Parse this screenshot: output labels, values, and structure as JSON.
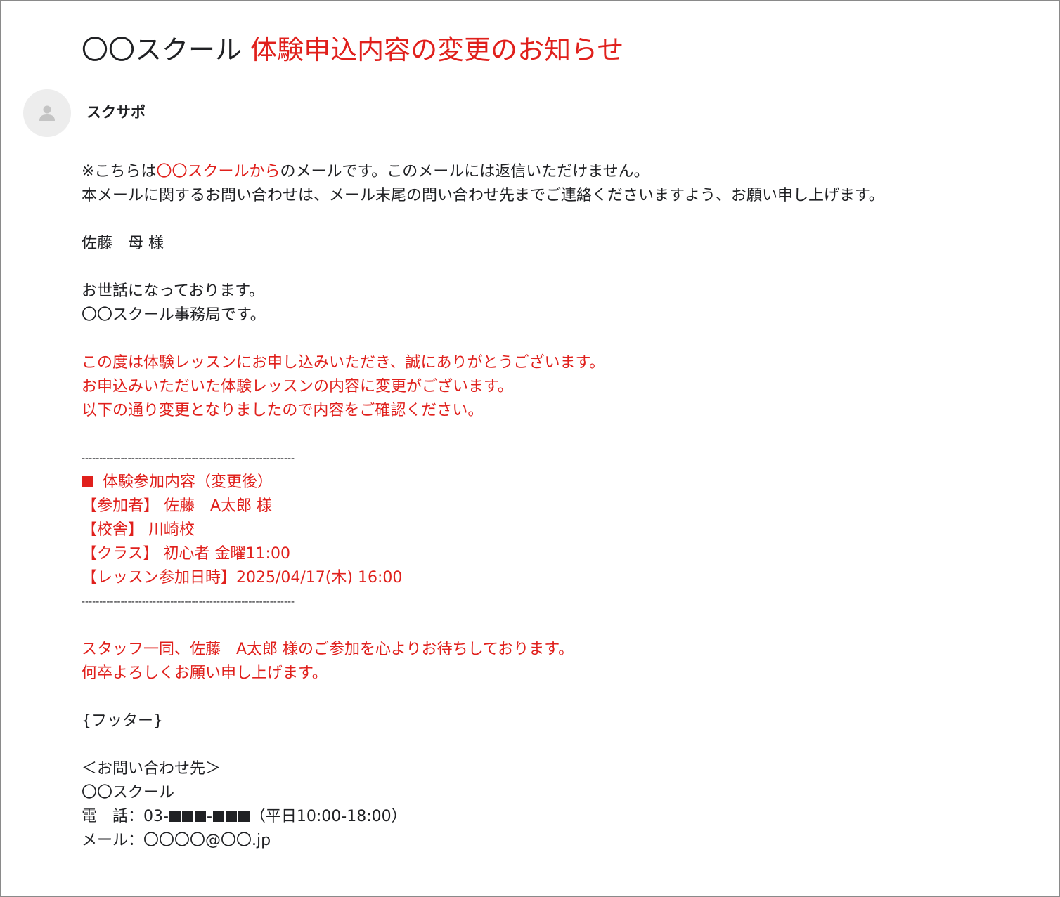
{
  "email": {
    "subject_prefix": "〇〇スクール ",
    "subject_highlight": "体験申込内容の変更のお知らせ",
    "sender": "スクサポ"
  },
  "body": {
    "notice_prefix": "※こちらは",
    "notice_highlight": "〇〇スクールから",
    "notice_suffix": "のメールです。このメールには返信いただけません。",
    "notice_line2": "本メールに関するお問い合わせは、メール末尾の問い合わせ先までご連絡くださいますよう、お願い申し上げます。",
    "recipient": "佐藤　母 様",
    "greeting_1": "お世話になっております。",
    "greeting_2": "〇〇スクール事務局です。",
    "intro_1": "この度は体験レッスンにお申し込みいただき、誠にありがとうございます。",
    "intro_2": "お申込みいただいた体験レッスンの内容に変更がございます。",
    "intro_3": "以下の通り変更となりましたので内容をご確認ください。",
    "divider": "------------------------------------------------------------",
    "section_title": "体験参加内容（変更後）",
    "participant": "【参加者】 佐藤　A太郎 様",
    "school": "【校舎】 川崎校",
    "class": "【クラス】 初心者 金曜11:00",
    "lesson_datetime": "【レッスン参加日時】2025/04/17(木) 16:00",
    "closing_1": "スタッフ一同、佐藤　A太郎 様のご参加を心よりお待ちしております。",
    "closing_2": "何卒よろしくお願い申し上げます。",
    "footer_placeholder": "{フッター}",
    "contact_heading": "＜お問い合わせ先＞",
    "contact_org": "〇〇スクール",
    "phone_label": "電　話：03-",
    "phone_sep": "-",
    "phone_hours": "（平日10:00-18:00）",
    "mail_line": "メール：〇〇〇〇@〇〇.jp"
  },
  "colors": {
    "accent": "#e0201c",
    "text": "#202124",
    "avatar_bg": "#ededed",
    "border": "#8a8a8a"
  },
  "icons": {
    "avatar": "person-icon"
  }
}
